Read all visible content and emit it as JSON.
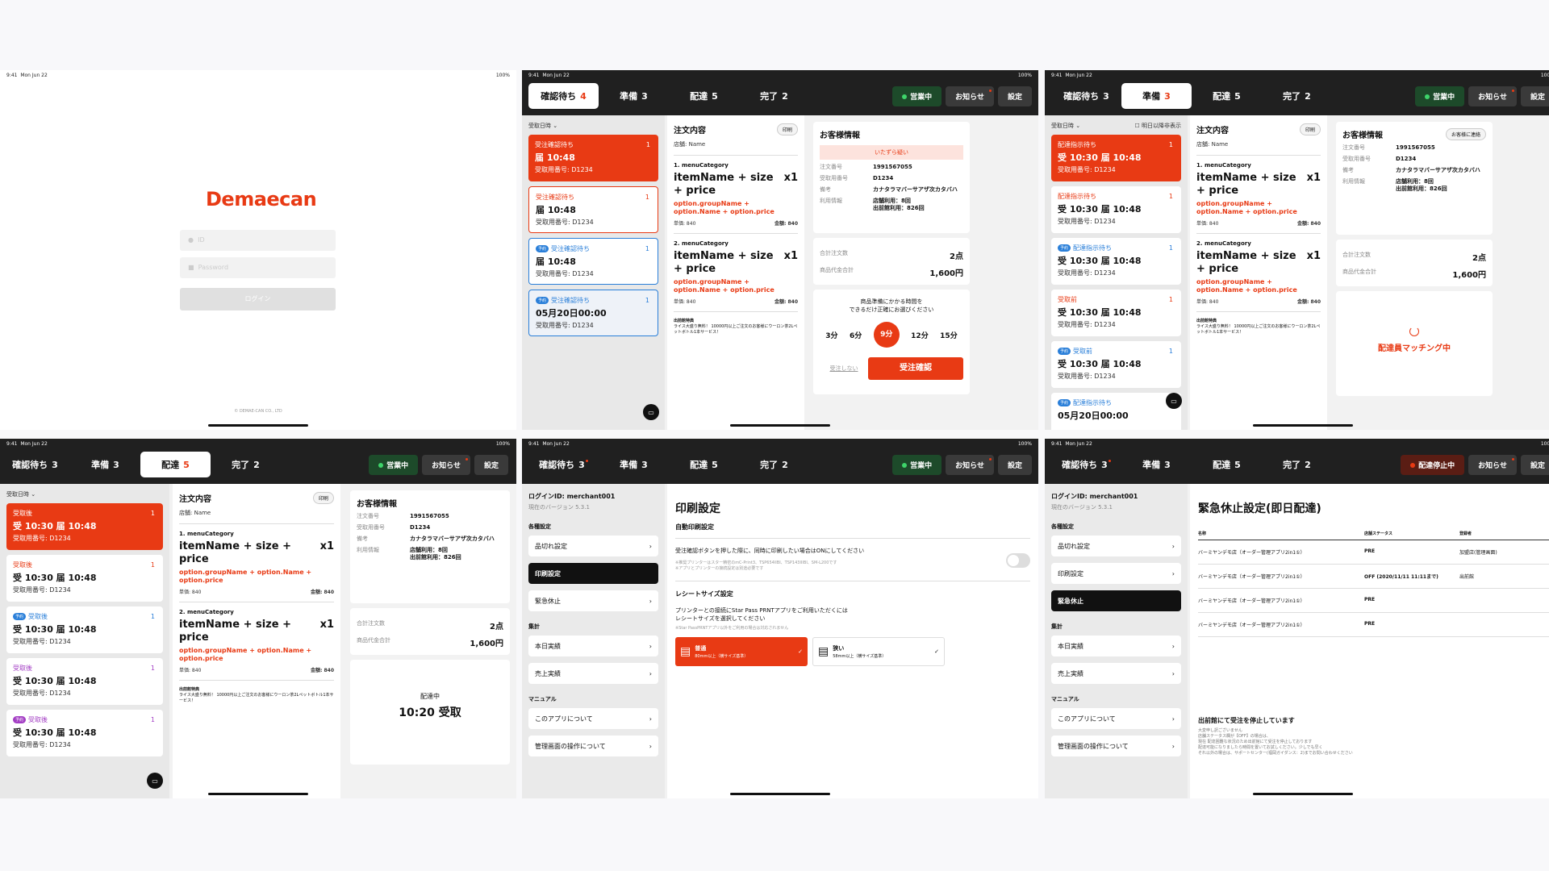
{
  "statusbar": {
    "time": "9:41",
    "date": "Mon Jun 22",
    "battery": "100%"
  },
  "login": {
    "logo": "Demaecan",
    "id_placeholder": "ID",
    "pw_placeholder": "Password",
    "login_label": "ログイン",
    "copyright": "© DEMAE-CAN CO., LTD"
  },
  "header": {
    "open_label": "営業中",
    "stopped_label": "配達停止中",
    "news_label": "お知らせ",
    "settings_label": "設定"
  },
  "tabs": [
    {
      "label": "確認待ち",
      "count": "4",
      "count2": "3"
    },
    {
      "label": "準備",
      "count": "3"
    },
    {
      "label": "配達",
      "count": "5"
    },
    {
      "label": "完了",
      "count": "2"
    }
  ],
  "filter": {
    "pickup_label": "受取日時",
    "next_day_label": "明日以降非表示"
  },
  "p2_cards": [
    {
      "status": "受注確認待ち",
      "time": "届 10:48",
      "number": "受取用番号: D1234",
      "n": "1"
    },
    {
      "status": "受注確認待ち",
      "time": "届 10:48",
      "number": "受取用番号: D1234",
      "n": "1"
    },
    {
      "status": "受注確認待ち",
      "badge": "予約",
      "time": "届 10:48",
      "number": "受取用番号: D1234",
      "n": "1"
    },
    {
      "status": "受注確認待ち",
      "badge": "予約",
      "time": "05月20日00:00",
      "number": "受取用番号: D1234",
      "n": "1"
    }
  ],
  "p3_cards": [
    {
      "status": "配達指示待ち",
      "time": "受 10:30 届 10:48",
      "number": "受取用番号: D1234",
      "n": "1"
    },
    {
      "status": "配達指示待ち",
      "time": "受 10:30 届 10:48",
      "number": "受取用番号: D1234",
      "n": "1"
    },
    {
      "status": "配達指示待ち",
      "badge": "予約",
      "time": "受 10:30 届 10:48",
      "number": "受取用番号: D1234",
      "n": "1"
    },
    {
      "status": "受取前",
      "time": "受 10:30 届 10:48",
      "number": "受取用番号: D1234",
      "n": "1"
    },
    {
      "status": "受取前",
      "badge": "予約",
      "time": "受 10:30 届 10:48",
      "number": "受取用番号: D1234",
      "n": "1"
    },
    {
      "status": "配達指示待ち",
      "badge": "予約",
      "time": "05月20日00:00",
      "number": "",
      "n": ""
    }
  ],
  "p4_cards": [
    {
      "status": "受取後",
      "time": "受 10:30 届 10:48",
      "number": "受取用番号: D1234",
      "n": "1"
    },
    {
      "status": "受取後",
      "time": "受 10:30 届 10:48",
      "number": "受取用番号: D1234",
      "n": "1"
    },
    {
      "status": "受取後",
      "badge": "予約",
      "time": "受 10:30 届 10:48",
      "number": "受取用番号: D1234",
      "n": "1"
    },
    {
      "status": "受取後",
      "time": "受 10:30 届 10:48",
      "number": "受取用番号: D1234",
      "n": "1"
    },
    {
      "status": "受取後",
      "badge": "予約",
      "time": "受 10:30 届 10:48",
      "number": "受取用番号: D1234",
      "n": "1"
    }
  ],
  "order": {
    "title": "注文内容",
    "print_label": "印刷",
    "store": "店舗: Name",
    "items": [
      {
        "category": "1. menuCategory",
        "name": "itemName + size + price",
        "qty": "x1",
        "option": "option.groupName + option.Name + option.price",
        "unit": "単価: 840",
        "amount": "金額: 840"
      },
      {
        "category": "2. menuCategory",
        "name": "itemName + size + price",
        "qty": "x1",
        "option": "option.groupName + option.Name + option.price",
        "unit": "単価: 840",
        "amount": "金額: 840"
      }
    ],
    "note_title": "出前館特典",
    "note": "ライス大盛り無料！ 10000円以上ご注文のお客様にウーロン茶2Lペットボトル1本サービス！"
  },
  "customer": {
    "title": "お客様情報",
    "contact_label": "お客様に連絡",
    "prank": "いたずら疑い",
    "order_no_label": "注文番号",
    "order_no": "1991567055",
    "pickup_no_label": "受取用番号",
    "pickup_no": "D1234",
    "memo_label": "備考",
    "memo": "カナタラマバーサアザ次カタバハ",
    "usage_label": "利用情報",
    "usage1": "店舗利用：8回",
    "usage2": "出前館利用：826回",
    "total_count_label": "合計注文数",
    "total_count": "2点",
    "total_price_label": "商品代金合計",
    "total_price": "1,600円"
  },
  "prep": {
    "prompt1": "商品準備にかかる時間を",
    "prompt2": "できるだけ正確にお選びください",
    "times": [
      "3分",
      "6分",
      "9分",
      "12分",
      "15分"
    ],
    "decline": "受注しない",
    "confirm": "受注確認"
  },
  "matching": "配達員マッチング中",
  "delivering": {
    "label": "配達中",
    "time": "10:20 受取"
  },
  "settings": {
    "login_id": "ログインID: merchant001",
    "version": "現在のバージョン 5.3.1",
    "sec1": "各種設定",
    "sec2": "集計",
    "sec3": "マニュアル",
    "items1": [
      "品切れ設定",
      "印刷設定",
      "緊急休止"
    ],
    "items2": [
      "本日実績",
      "売上実績"
    ],
    "items3": [
      "このアプリについて",
      "管理画面の操作について"
    ]
  },
  "print": {
    "title": "印刷設定",
    "auto_title": "自動印刷設定",
    "auto_desc": "受注確認ボタンを押した際に、同時に印刷したい場合はONにしてください",
    "auto_note1": "※推奨プリンターはスター精密のmC-Print3、TSP654IIBI、TSP143IIIBI、SM-L200です",
    "auto_note2": "※アプリとプリンターの接続設定は別途必要です",
    "receipt_title": "レシートサイズ設定",
    "receipt_desc1": "プリンターとの接続にStar Pass PRNTアプリをご利用いただくには",
    "receipt_desc2": "レシートサイズを選択してください",
    "receipt_note": "※Star PassPRNTアプリ以外をご利用の場合は対応されません",
    "normal": "普通",
    "normal_sub": "80mm以上（横サイズ基準）",
    "narrow": "狭い",
    "narrow_sub": "58mm以上（横サイズ基準）"
  },
  "emergency": {
    "title": "緊急休止設定(即日配達)",
    "headers": [
      "名称",
      "店舗ステータス",
      "登録者"
    ],
    "rows": [
      {
        "name": "バーミヤンデモ店（オーダー管理アプリ2in1①）",
        "status": "PRE",
        "reg": "加盟店(管理画面)"
      },
      {
        "name": "バーミヤンデモ店（オーダー管理アプリ2in1①）",
        "status": "OFF (2020/11/11 11:11まで)",
        "reg": "出前館"
      },
      {
        "name": "バーミヤンデモ店（オーダー管理アプリ2in1①）",
        "status": "PRE",
        "reg": ""
      },
      {
        "name": "バーミヤンデモ店（オーダー管理アプリ2in1①）",
        "status": "PRE",
        "reg": ""
      }
    ],
    "notice_title": "出前館にて受注を停止しています",
    "notice1": "大変申し訳ございません",
    "notice2": "店舗ステータス欄が【OFF】の場合は、",
    "notice3": "現在 配達困難な状況のため出前館にて受注を停止しております",
    "notice4": "配達可能になりましたら時間を置いてお試しください。少しでも早く",
    "notice5": "それ以外の場合は、サポートセンター(福岡ガイダンス：2)までお問い合わせください"
  },
  "colors": {
    "brand": "#e83a14",
    "blue": "#2a7fd9",
    "purple": "#a33ec4"
  }
}
